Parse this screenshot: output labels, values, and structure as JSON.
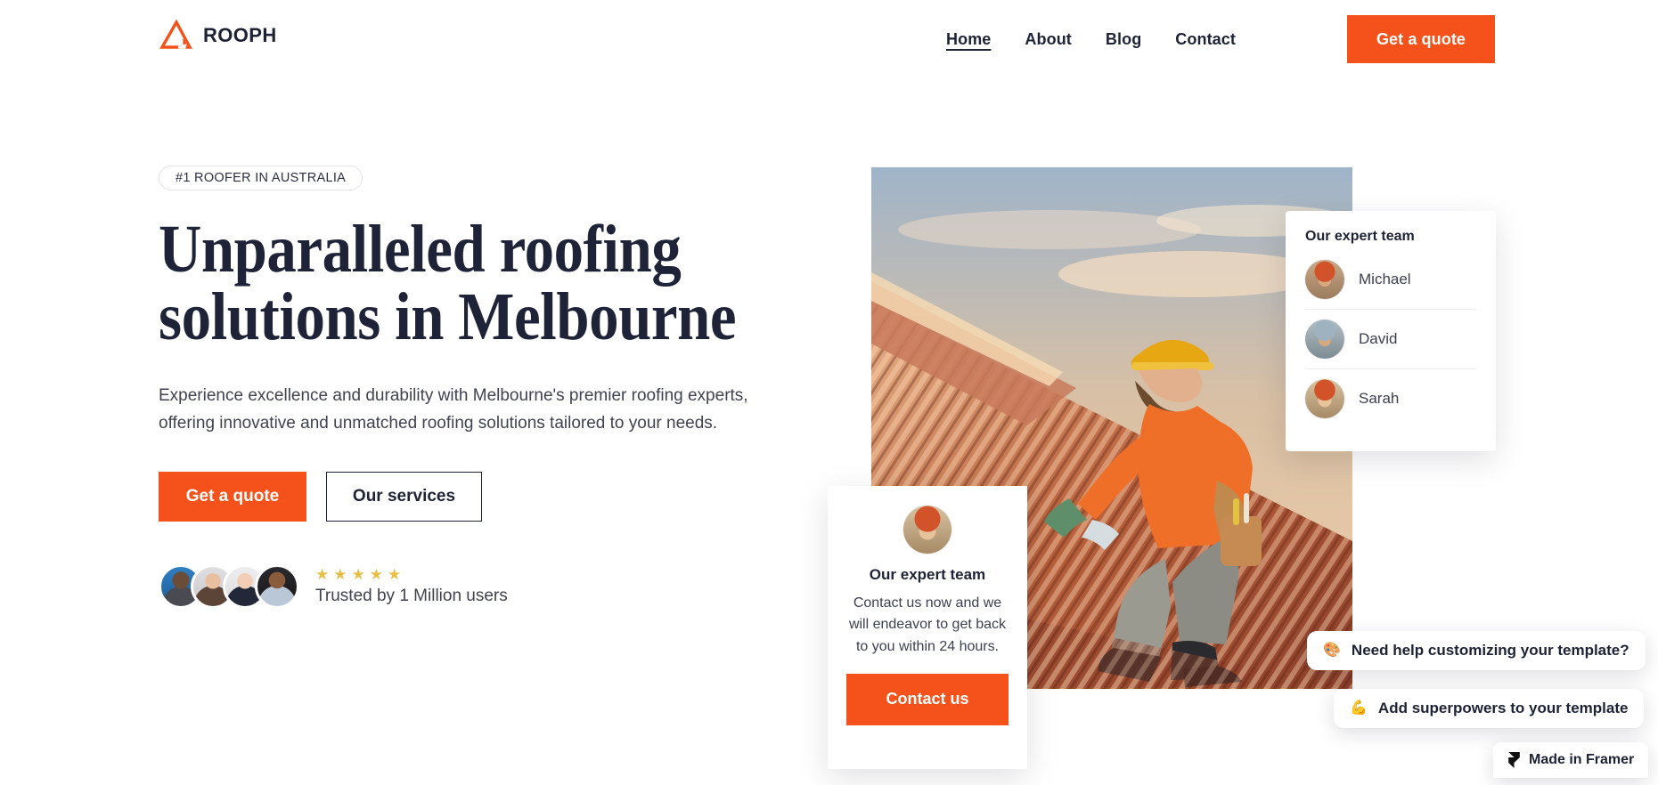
{
  "brand": {
    "name": "ROOPH",
    "logo_icon": "triangle-logo-icon",
    "accent_color": "#F4521A",
    "text_color": "#1E2235"
  },
  "header": {
    "nav": [
      {
        "label": "Home",
        "active": true
      },
      {
        "label": "About",
        "active": false
      },
      {
        "label": "Blog",
        "active": false
      },
      {
        "label": "Contact",
        "active": false
      }
    ],
    "cta_label": "Get a quote"
  },
  "hero": {
    "badge": "#1 ROOFER IN AUSTRALIA",
    "headline_line1": "Unparalleled roofing",
    "headline_line2": "solutions in Melbourne",
    "subhead": "Experience excellence and durability with Melbourne's premier roofing experts, offering innovative and unmatched roofing solutions tailored to your needs.",
    "primary_cta": "Get a quote",
    "secondary_cta": "Our services",
    "rating_stars": 5,
    "star_color": "#E7BE46",
    "trusted_text": "Trusted by 1 Million users",
    "photo_alt": "Roofer installing tiles on a roof at sunset"
  },
  "team_card": {
    "title": "Our expert team",
    "members": [
      {
        "name": "Michael"
      },
      {
        "name": "David"
      },
      {
        "name": "Sarah"
      }
    ]
  },
  "contact_card": {
    "title": "Our expert team",
    "body": "Contact us now and we will endeavor to get back to you within 24 hours.",
    "cta_label": "Contact us"
  },
  "floating": {
    "help": {
      "icon": "palette-icon",
      "glyph": "🎨",
      "label": "Need help customizing your template?"
    },
    "superpowers": {
      "icon": "flexed-biceps-icon",
      "glyph": "💪",
      "label": "Add superpowers to your template"
    },
    "framer": {
      "icon": "framer-logo-icon",
      "label": "Made in Framer"
    }
  }
}
